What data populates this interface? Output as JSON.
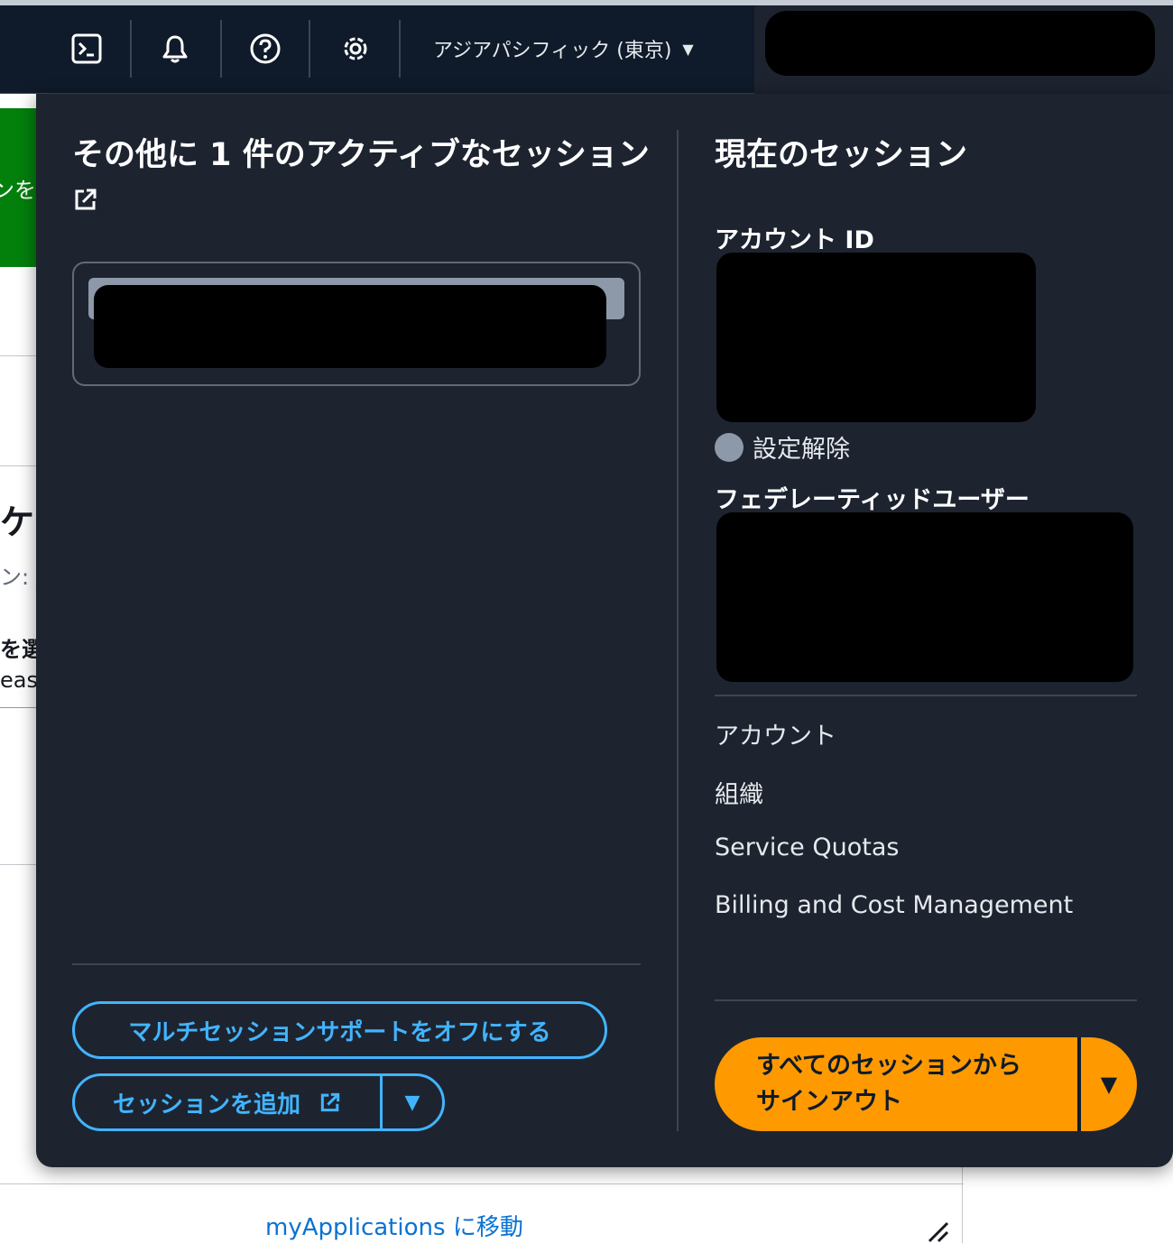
{
  "topnav": {
    "region_label": "アジアパシフィック (東京)",
    "caret": "▼"
  },
  "background": {
    "green_button_fragment": "ンを",
    "heading_fragment": "ケ",
    "subtext_fragment": "ン: /",
    "select_label_fragment": "を選",
    "region_value_fragment": "east",
    "footer_link": "myApplications",
    "footer_link_suffix": "に移動"
  },
  "sessions_panel": {
    "other_sessions_title": "その他に 1 件のアクティブなセッション",
    "current_session_title": "現在のセッション",
    "account_id_label": "アカウント ID",
    "status_text": "設定解除",
    "federated_user_label": "フェデレーティッドユーザー",
    "menu_links": [
      "アカウント",
      "組織",
      "Service Quotas",
      "Billing and Cost Management"
    ],
    "turn_off_multisession_button": "マルチセッションサポートをオフにする",
    "add_session_button": "セッションを追加",
    "signout_button_line1": "すべてのセッションから",
    "signout_button_line2": "サインアウト",
    "dropdown_arrow": "▼"
  },
  "colors": {
    "nav_bg": "#0f1b2a",
    "panel_bg": "#1d2430",
    "link_blue": "#42b4ff",
    "accent_orange": "#ff9900",
    "success_green": "#037f0c"
  }
}
